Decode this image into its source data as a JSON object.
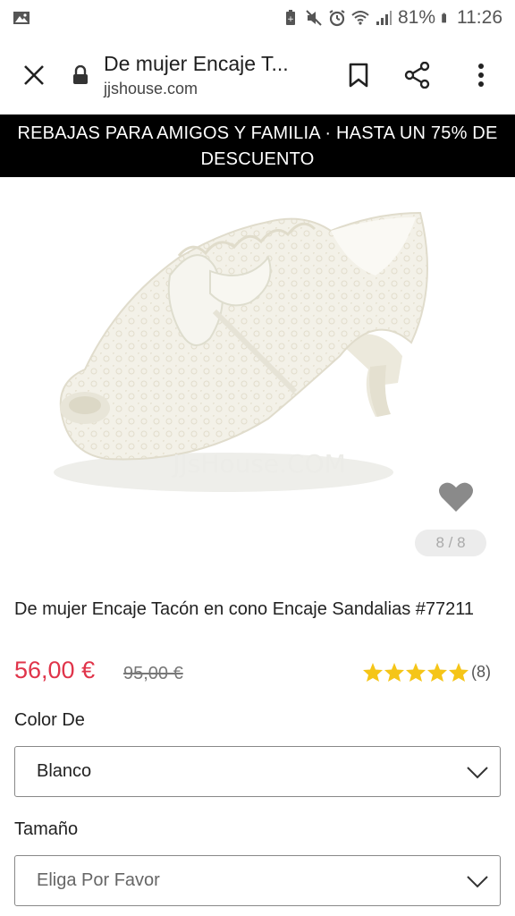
{
  "status_bar": {
    "battery": "81%",
    "time": "11:26"
  },
  "toolbar": {
    "page_title": "De mujer Encaje T...",
    "url": "jjshouse.com"
  },
  "promo": {
    "text": "REBAJAS PARA AMIGOS Y FAMILIA · HASTA UN 75% DE DESCUENTO"
  },
  "gallery": {
    "counter": "8 / 8"
  },
  "product": {
    "name": "De mujer Encaje Tacón en cono Encaje Sandalias #77211",
    "price": "56,00 €",
    "old_price": "95,00 €",
    "rating_stars": 5,
    "review_count": "(8)",
    "star_color": "#f5c518",
    "price_color": "#e0344a"
  },
  "options": {
    "color_label": "Color De",
    "color_value": "Blanco",
    "size_label": "Tamaño",
    "size_placeholder": "Eliga Por Favor"
  }
}
